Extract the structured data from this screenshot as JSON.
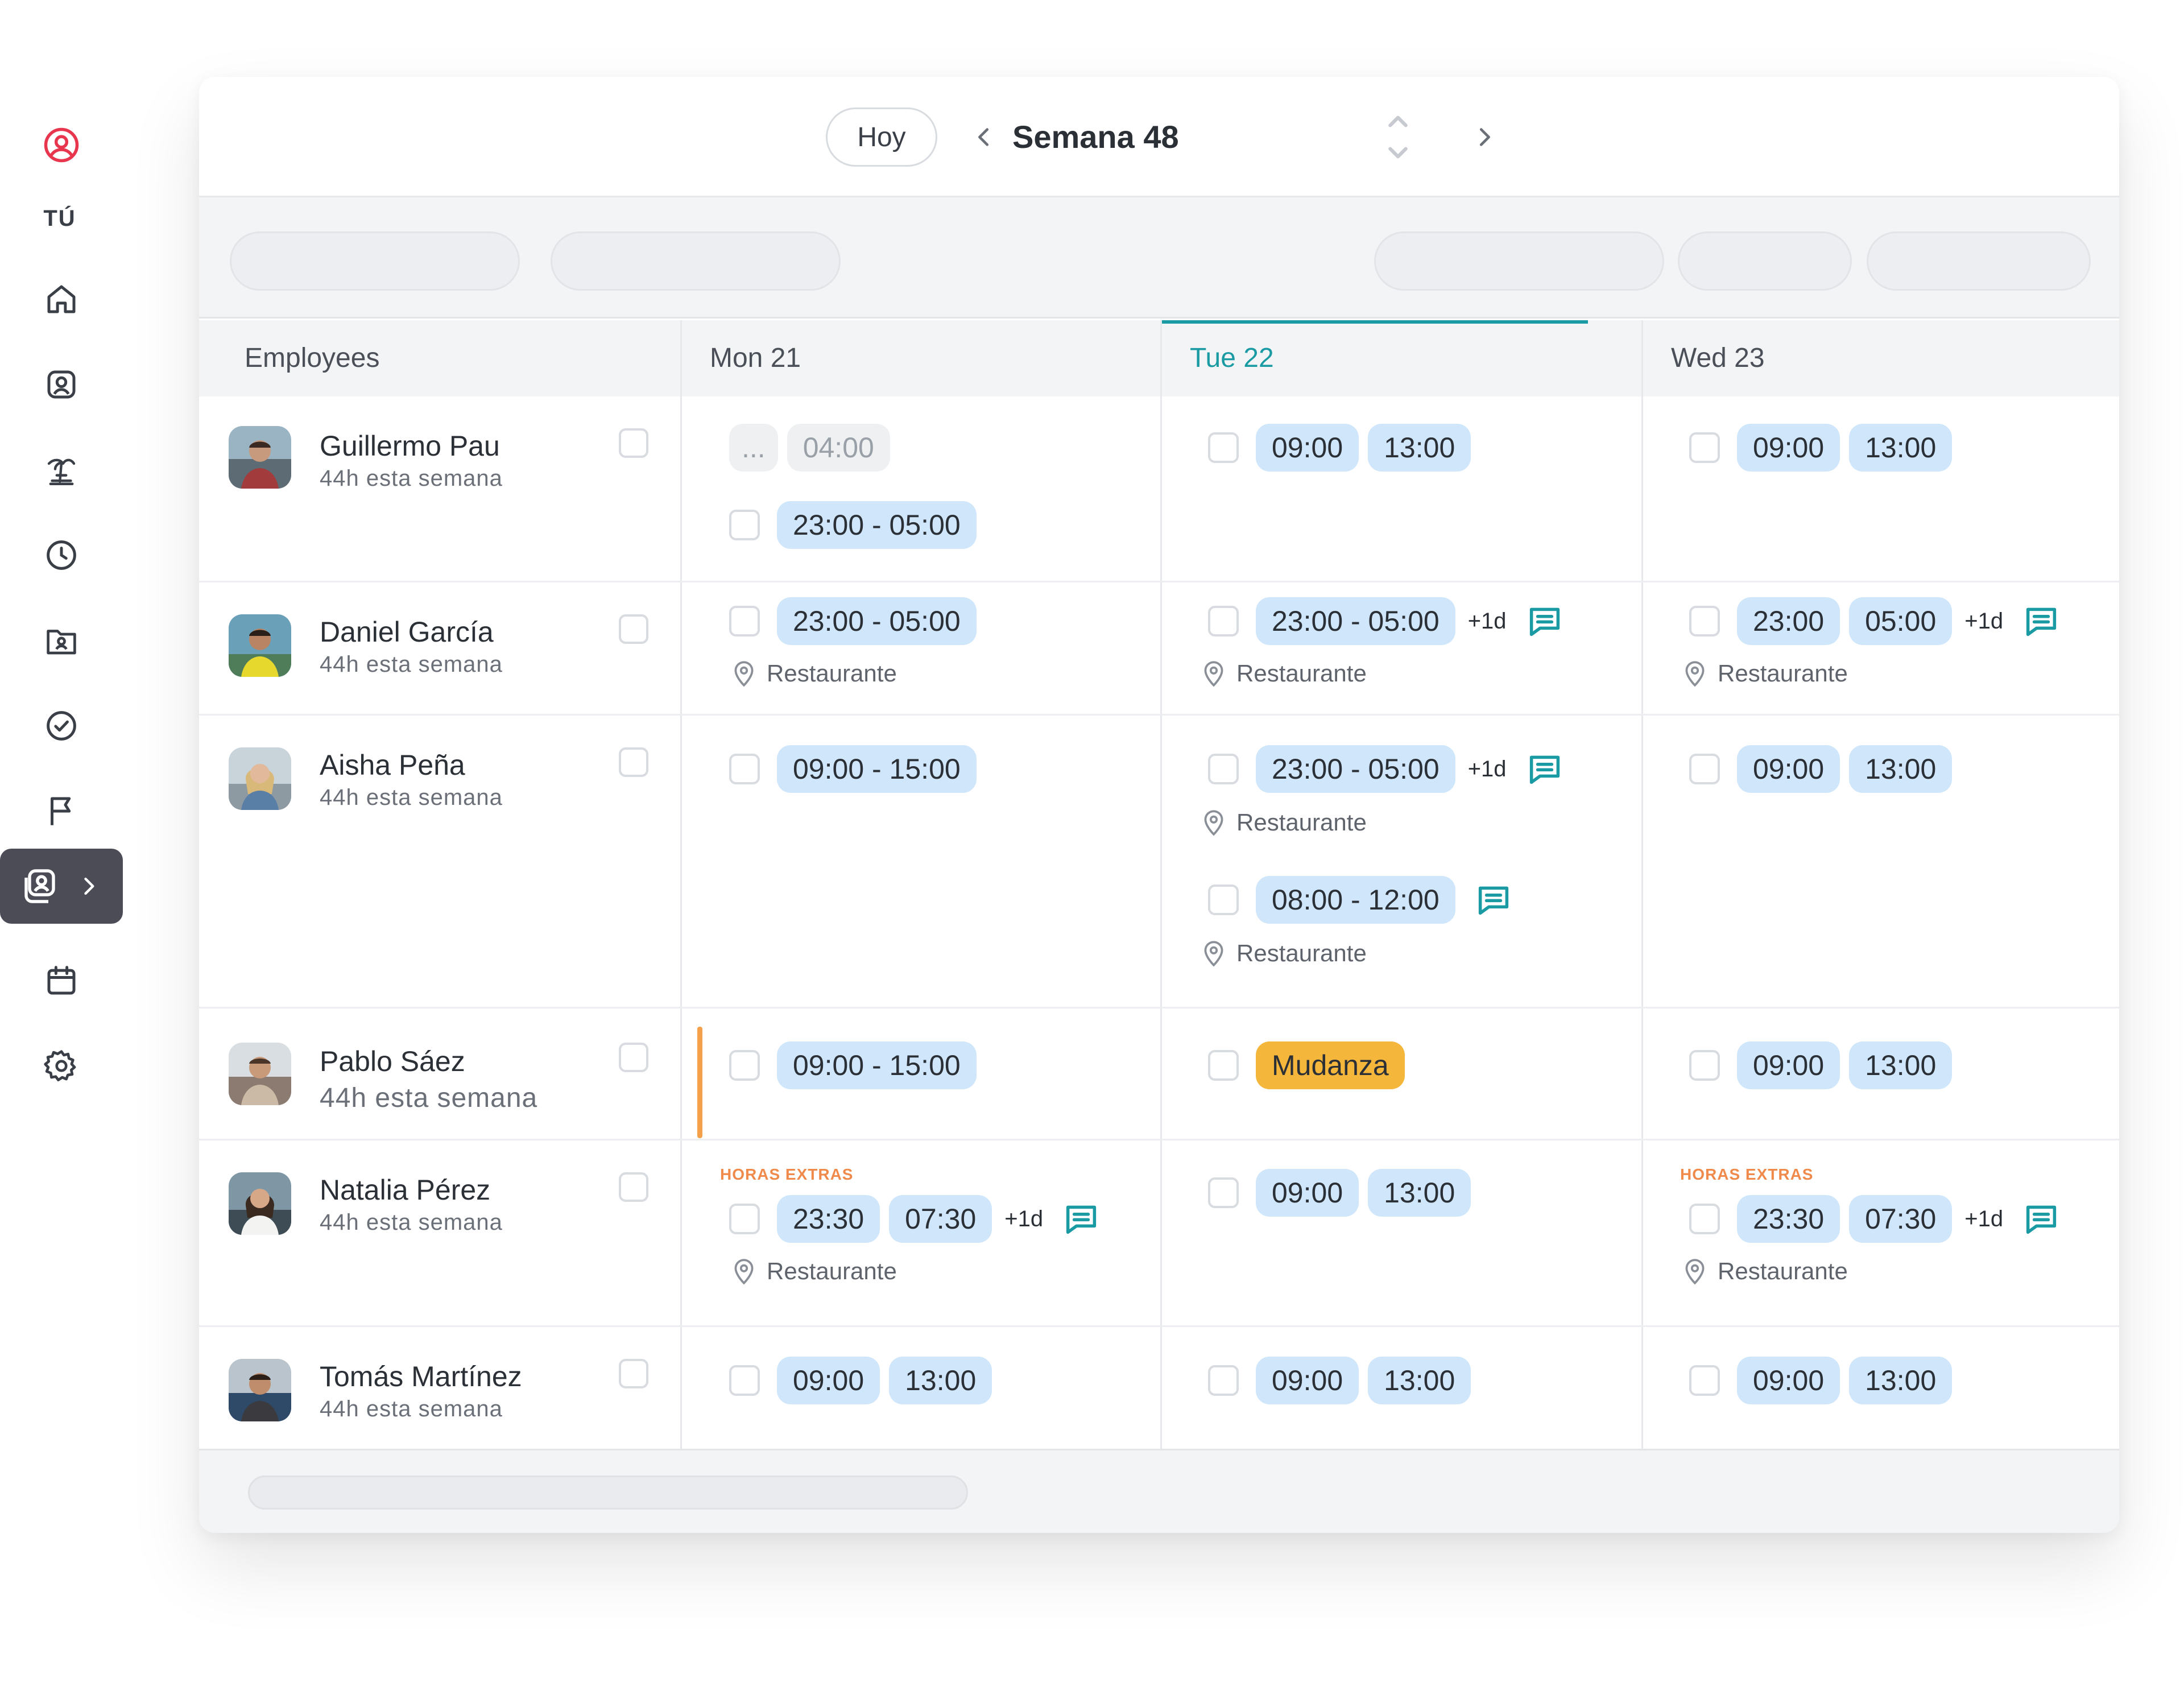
{
  "sidebar": {
    "you_label": "TÚ",
    "items": [
      {
        "icon": "home-icon"
      },
      {
        "icon": "profile-icon"
      },
      {
        "icon": "vacation-icon"
      },
      {
        "icon": "clock-icon"
      },
      {
        "icon": "documents-icon"
      },
      {
        "icon": "check-circle-icon"
      },
      {
        "icon": "flag-icon"
      },
      {
        "icon": "team-icon",
        "active": true
      },
      {
        "icon": "calendar-icon"
      },
      {
        "icon": "settings-icon"
      }
    ],
    "accent_color": "#e8364f",
    "active_bg": "#4b4c56"
  },
  "toolbar": {
    "today_label": "Hoy",
    "week_label": "Semana 48"
  },
  "header": {
    "employees_label": "Employees",
    "days": [
      {
        "label": "Mon 21",
        "today": false
      },
      {
        "label": "Tue 22",
        "today": true
      },
      {
        "label": "Wed 23",
        "today": false
      }
    ]
  },
  "colors": {
    "chip_bg": "#cfe6fb",
    "today_accent": "#1a9aa3",
    "absence_chip": "#f5b73b",
    "overtime": "#f08a4b"
  },
  "rows": [
    {
      "name": "Guillermo Pau",
      "hours": "44h esta semana",
      "mon": {
        "more": "...",
        "pending": "04:00",
        "shift": "23:00 - 05:00"
      },
      "tue": {
        "start": "09:00",
        "end": "13:00"
      },
      "wed": {
        "start": "09:00",
        "end": "13:00"
      }
    },
    {
      "name": "Daniel García",
      "hours": "44h esta semana",
      "mon": {
        "shift": "23:00 - 05:00",
        "location": "Restaurante"
      },
      "tue": {
        "shift": "23:00 - 05:00",
        "plus": "+1d",
        "location": "Restaurante"
      },
      "wed": {
        "start": "23:00",
        "end": "05:00",
        "plus": "+1d",
        "location": "Restaurante"
      }
    },
    {
      "name": "Aisha Peña",
      "hours": "44h esta semana",
      "mon": {
        "shift": "09:00 - 15:00"
      },
      "tue": {
        "shift": "23:00 - 05:00",
        "plus": "+1d",
        "location": "Restaurante",
        "shift2": "08:00 - 12:00",
        "location2": "Restaurante"
      },
      "wed": {
        "start": "09:00",
        "end": "13:00"
      }
    },
    {
      "name": "Pablo Sáez",
      "hours": "44h esta semana",
      "mon": {
        "shift": "09:00 - 15:00"
      },
      "tue": {
        "absence": "Mudanza"
      },
      "wed": {
        "start": "09:00",
        "end": "13:00"
      }
    },
    {
      "name": "Natalia Pérez",
      "hours": "44h esta semana",
      "mon": {
        "extras": "HORAS EXTRAS",
        "start": "23:30",
        "end": "07:30",
        "plus": "+1d",
        "location": "Restaurante"
      },
      "tue": {
        "start": "09:00",
        "end": "13:00"
      },
      "wed": {
        "extras": "HORAS EXTRAS",
        "start": "23:30",
        "end": "07:30",
        "plus": "+1d",
        "location": "Restaurante"
      }
    },
    {
      "name": "Tomás Martínez",
      "hours": "44h esta semana",
      "mon": {
        "start": "09:00",
        "end": "13:00"
      },
      "tue": {
        "start": "09:00",
        "end": "13:00"
      },
      "wed": {
        "start": "09:00",
        "end": "13:00"
      }
    }
  ]
}
